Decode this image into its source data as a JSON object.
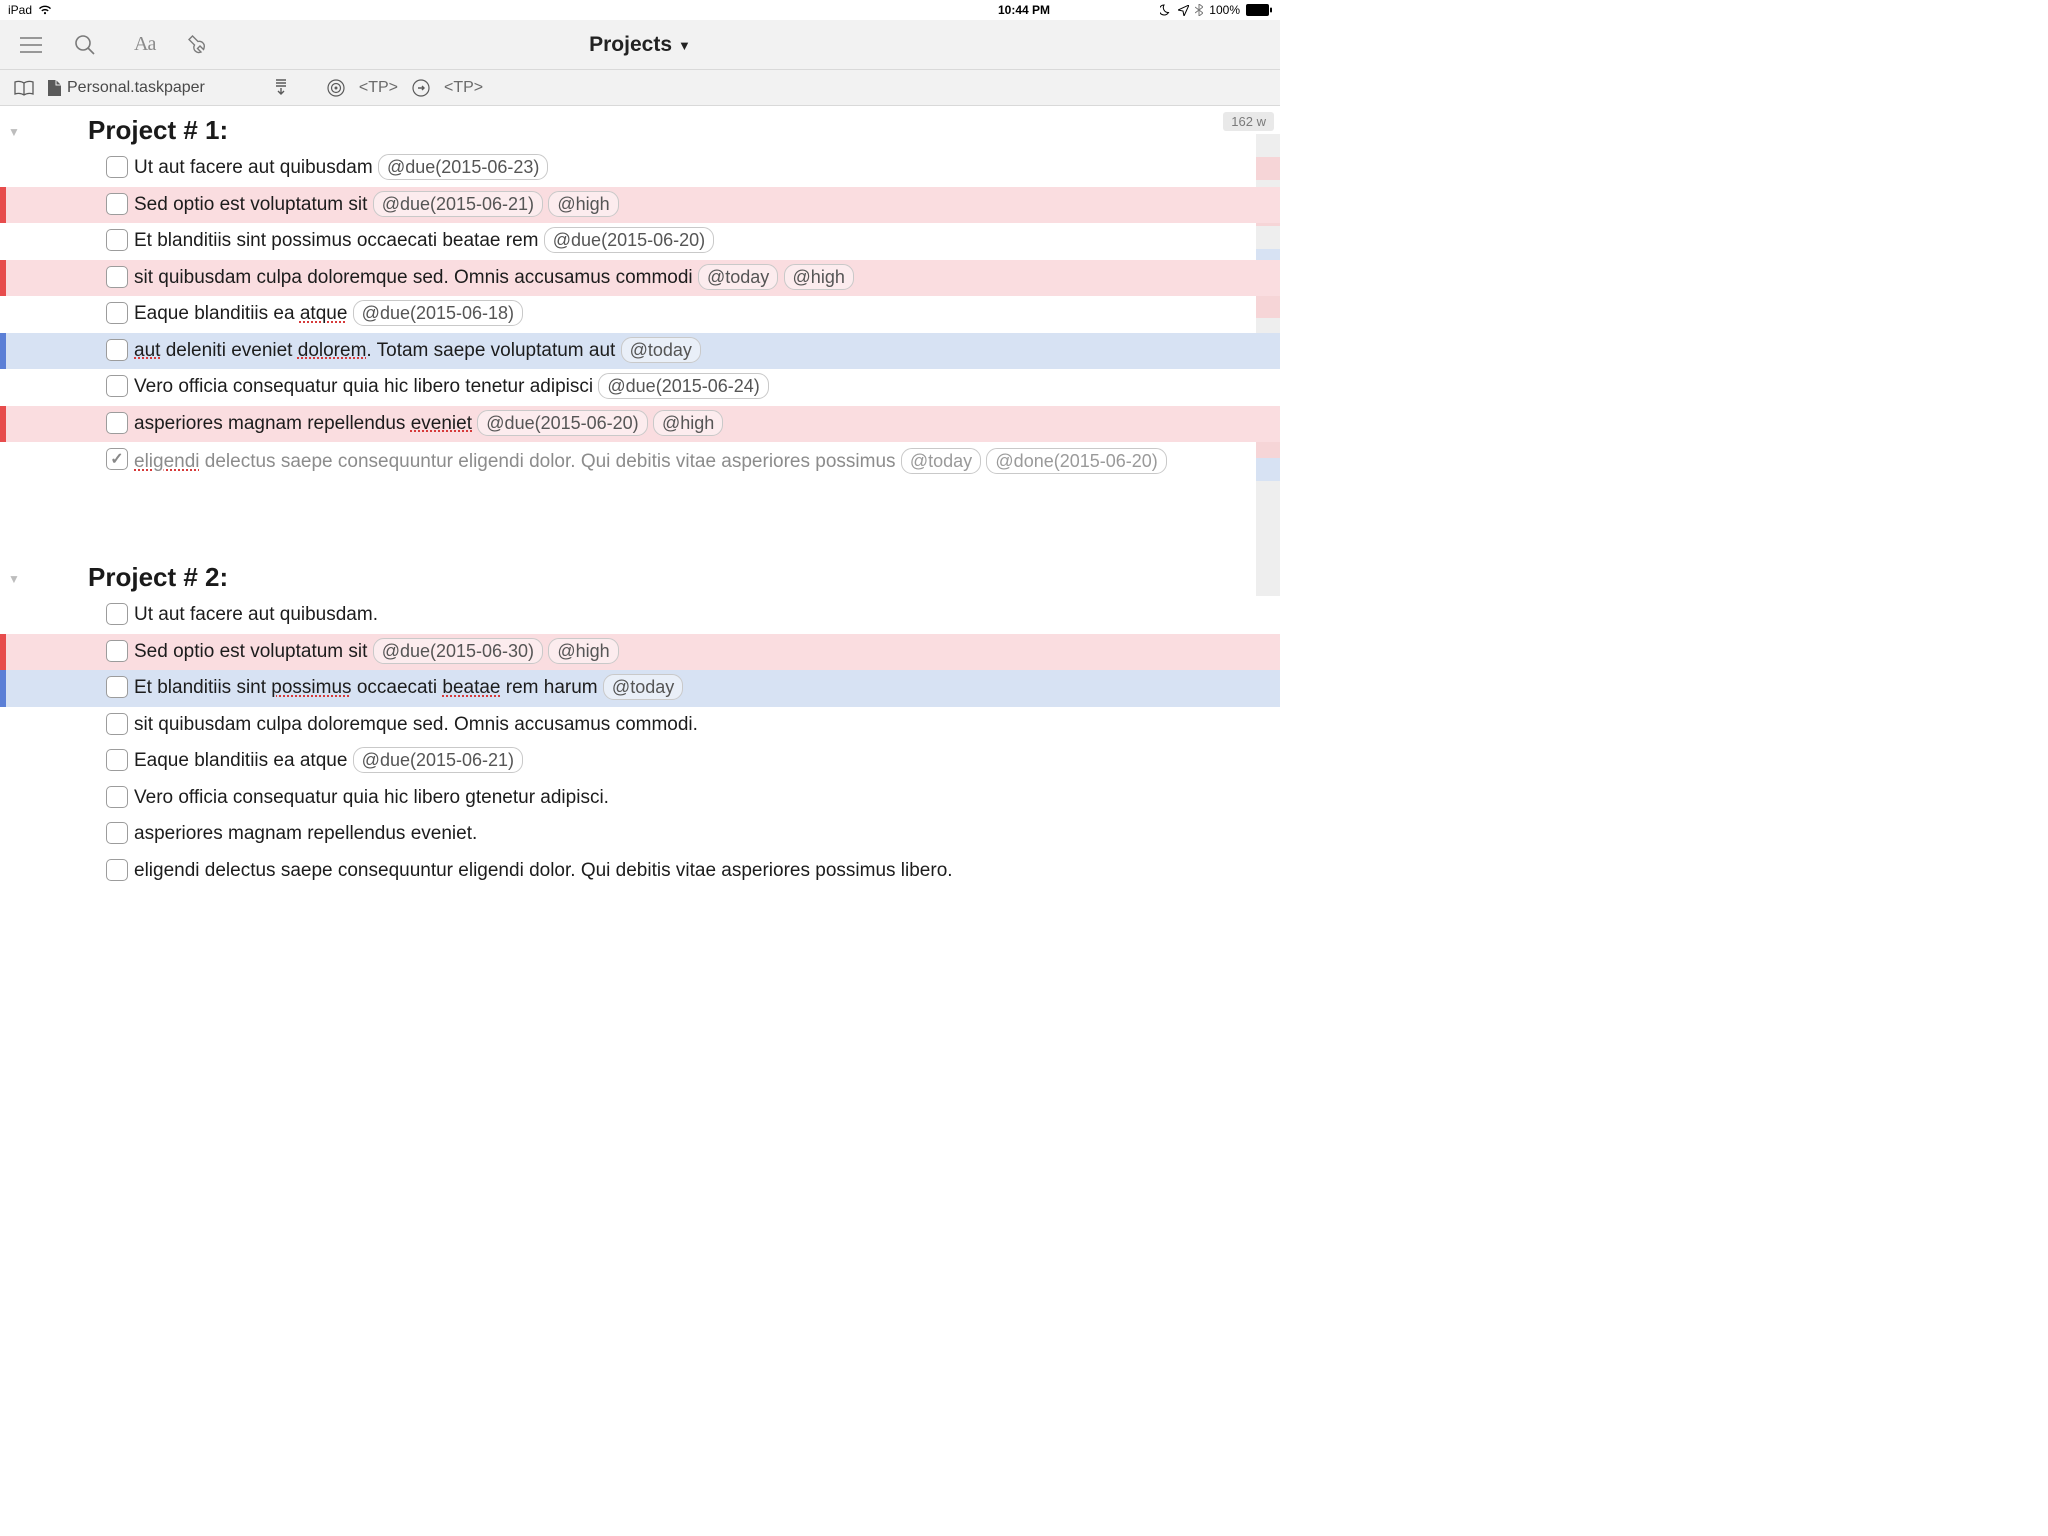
{
  "status": {
    "device": "iPad",
    "time": "10:44 PM",
    "battery": "100%"
  },
  "navbar": {
    "title": "Projects"
  },
  "subbar": {
    "filename": "Personal.taskpaper",
    "tp1": "<TP>",
    "tp2": "<TP>"
  },
  "word_count": "162 w",
  "projects": [
    {
      "title": "Project # 1:",
      "tasks": [
        {
          "text": "Ut aut facere aut quibusdam",
          "tags": [
            "@due(2015-06-23)"
          ],
          "hl": "",
          "done": false,
          "spell": []
        },
        {
          "text": "Sed optio est voluptatum sit",
          "tags": [
            "@due(2015-06-21)",
            "@high"
          ],
          "hl": "high",
          "done": false,
          "spell": []
        },
        {
          "text": "Et blanditiis sint possimus occaecati beatae rem ",
          "tags": [
            "@due(2015-06-20)"
          ],
          "hl": "",
          "done": false,
          "spell": []
        },
        {
          "text": "sit quibusdam culpa doloremque sed. Omnis accusamus commodi",
          "tags": [
            "@today",
            "@high"
          ],
          "hl": "high",
          "done": false,
          "spell": []
        },
        {
          "text": "Eaque blanditiis ea atque",
          "tags": [
            "@due(2015-06-18)"
          ],
          "hl": "",
          "done": false,
          "spell": [
            "atque"
          ]
        },
        {
          "text": "aut deleniti eveniet dolorem. Totam saepe voluptatum aut",
          "tags": [
            "@today"
          ],
          "hl": "today",
          "done": false,
          "spell": [
            "aut",
            "dolorem"
          ]
        },
        {
          "text": "Vero officia consequatur quia hic libero tenetur adipisci",
          "tags": [
            "@due(2015-06-24)"
          ],
          "hl": "",
          "done": false,
          "spell": []
        },
        {
          "text": "asperiores magnam repellendus eveniet",
          "tags": [
            "@due(2015-06-20)",
            "@high"
          ],
          "hl": "high",
          "done": false,
          "spell": [
            "eveniet"
          ]
        },
        {
          "text": "eligendi delectus saepe consequuntur eligendi dolor. Qui debitis vitae asperiores possimus",
          "tags": [
            "@today",
            "@done(2015-06-20)"
          ],
          "hl": "",
          "done": true,
          "wrap": true,
          "spell": [
            "eligendi"
          ]
        }
      ]
    },
    {
      "title": "Project # 2:",
      "tasks": [
        {
          "text": "Ut aut facere aut quibusdam.",
          "tags": [],
          "hl": "",
          "done": false,
          "spell": []
        },
        {
          "text": "Sed optio est voluptatum sit",
          "tags": [
            "@due(2015-06-30)",
            "@high"
          ],
          "hl": "high",
          "done": false,
          "spell": []
        },
        {
          "text": "Et blanditiis sint possimus occaecati beatae rem harum",
          "tags": [
            "@today"
          ],
          "hl": "today",
          "done": false,
          "spell": [
            "possimus",
            "beatae"
          ]
        },
        {
          "text": "sit quibusdam culpa doloremque sed. Omnis accusamus commodi.",
          "tags": [],
          "hl": "",
          "done": false,
          "spell": []
        },
        {
          "text": "Eaque blanditiis ea atque",
          "tags": [
            "@due(2015-06-21)"
          ],
          "hl": "",
          "done": false,
          "spell": []
        },
        {
          "text": "Vero officia consequatur quia hic libero gtenetur adipisci.",
          "tags": [],
          "hl": "",
          "done": false,
          "spell": []
        },
        {
          "text": "asperiores magnam repellendus eveniet.",
          "tags": [],
          "hl": "",
          "done": false,
          "spell": []
        },
        {
          "text": "eligendi delectus saepe consequuntur eligendi dolor. Qui debitis vitae asperiores possimus libero.",
          "tags": [],
          "hl": "",
          "done": false,
          "spell": []
        }
      ]
    }
  ]
}
